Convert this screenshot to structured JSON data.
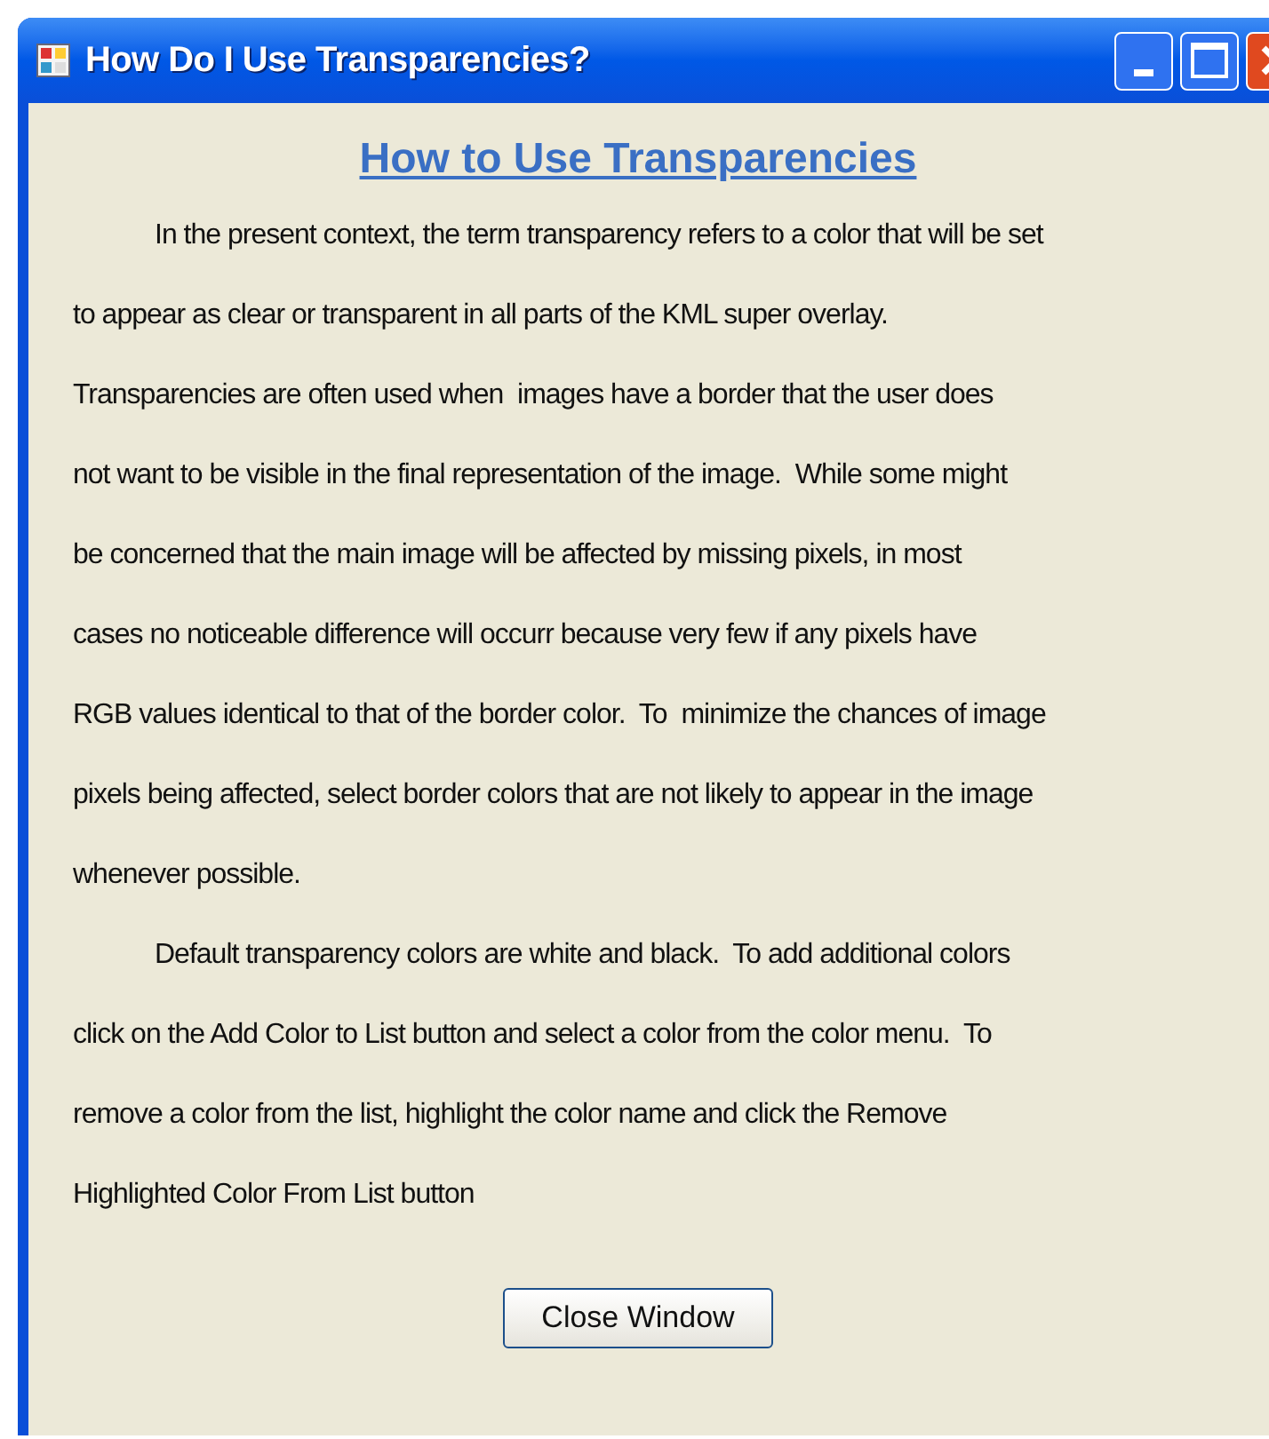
{
  "window": {
    "title": "How Do I Use Transparencies?"
  },
  "heading": "How to Use Transparencies",
  "paragraphs": [
    {
      "lines": [
        "In the present context, the term transparency refers to a color that will be set",
        "to appear as clear or transparent in all parts of the KML super overlay.",
        "Transparencies are often used when  images have a border that the user does",
        "not want to be visible in the final representation of the image.  While some might",
        "be concerned that the main image will be affected by missing pixels, in most",
        "cases no noticeable difference will occurr because very few if any pixels have",
        "RGB values identical to that of the border color.  To  minimize the chances of image",
        "pixels being affected, select border colors that are not likely to appear in the image",
        "whenever possible."
      ]
    },
    {
      "lines": [
        "Default transparency colors are white and black.  To add additional colors",
        "click on the Add Color to List button and select a color from the color menu.  To",
        "remove a color from the list, highlight the color name and click the Remove",
        "Highlighted Color From List button"
      ]
    }
  ],
  "buttons": [
    "Close Window"
  ]
}
